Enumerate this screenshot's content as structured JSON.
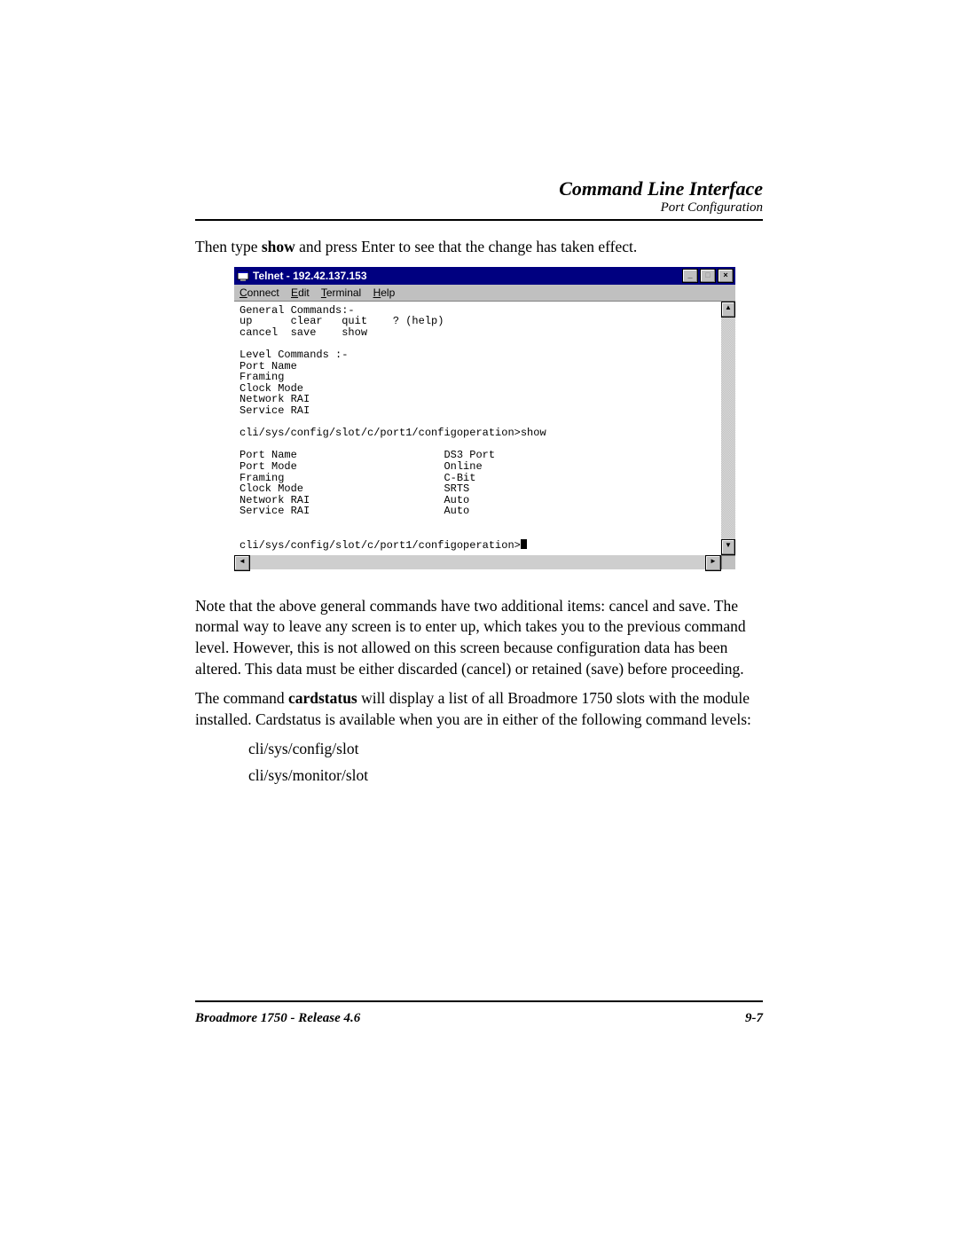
{
  "header": {
    "title": "Command Line Interface",
    "subtitle": "Port Configuration"
  },
  "intro": {
    "pre": "Then type ",
    "bold": "show",
    "post": " and press Enter to see that the change has taken effect."
  },
  "telnet": {
    "title": "Telnet - 192.42.137.153",
    "menu": {
      "connect": "Connect",
      "edit": "Edit",
      "terminal": "Terminal",
      "help": "Help"
    },
    "winbtn": {
      "min": "_",
      "max": "□",
      "close": "×"
    },
    "scroll": {
      "up": "▲",
      "down": "▼",
      "left": "◄",
      "right": "►"
    },
    "content": "General Commands:-\nup      clear   quit    ? (help)\ncancel  save    show\n\nLevel Commands :-\nPort Name\nFraming\nClock Mode\nNetwork RAI\nService RAI\n\ncli/sys/config/slot/c/port1/configoperation>show\n\nPort Name                       DS3 Port\nPort Mode                       Online\nFraming                         C-Bit\nClock Mode                      SRTS\nNetwork RAI                     Auto\nService RAI                     Auto\n\n\ncli/sys/config/slot/c/port1/configoperation>"
  },
  "para1": "Note that the above general commands have two additional items: cancel and save. The normal way to leave any screen is to enter up, which takes you to the previous command level. However, this is not allowed on this screen because configuration data has been altered. This data must be either discarded (cancel) or retained (save) before proceeding.",
  "para2": {
    "pre": "The command ",
    "bold": "cardstatus",
    "post": " will display a list of all Broadmore 1750 slots with the module installed. Cardstatus is available when you are in either of the following command levels:"
  },
  "cmdlevels": [
    "cli/sys/config/slot",
    "cli/sys/monitor/slot"
  ],
  "footer": {
    "left": "Broadmore 1750 - Release 4.6",
    "right": "9-7"
  }
}
